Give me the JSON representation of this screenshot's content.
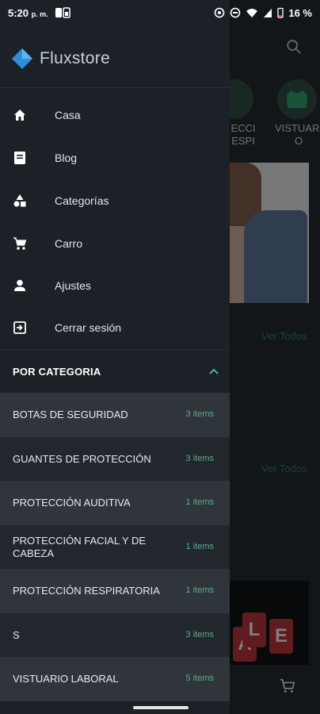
{
  "status_bar": {
    "time": "5:20",
    "ampm": "p. m.",
    "battery": "16 %"
  },
  "drawer": {
    "brand": "Fluxstore",
    "menu": [
      {
        "label": "Casa",
        "icon": "home-icon"
      },
      {
        "label": "Blog",
        "icon": "blog-icon"
      },
      {
        "label": "Categorías",
        "icon": "categories-icon"
      },
      {
        "label": "Carro",
        "icon": "cart-icon"
      },
      {
        "label": "Ajustes",
        "icon": "person-icon"
      },
      {
        "label": "Cerrar sesión",
        "icon": "logout-icon"
      }
    ],
    "category_header": "POR CATEGORIA",
    "categories": [
      {
        "name": "BOTAS DE SEGURIDAD",
        "count": "3 items"
      },
      {
        "name": "GUANTES DE PROTECCIÓN",
        "count": "3 items"
      },
      {
        "name": "PROTECCIÓN AUDITIVA",
        "count": "1 items"
      },
      {
        "name": "PROTECCIÓN FACIAL Y DE CABEZA",
        "count": "1 items"
      },
      {
        "name": "PROTECCIÓN RESPIRATORIA",
        "count": "1 items"
      },
      {
        "name": "S",
        "count": "3 items"
      },
      {
        "name": "VISTUARIO LABORAL",
        "count": "5 items"
      }
    ]
  },
  "background": {
    "cat_label_1": "ECCI\nESPI",
    "cat_label_2": "VISTUARI\nO",
    "see_all_1": "Ver Todos",
    "see_all_2": "Ver Todos",
    "sale_letters": [
      "A",
      "L",
      "E"
    ]
  },
  "colors": {
    "drawer_bg": "#1c2127",
    "row_alt": "#30353c",
    "accent_green": "#5fa886"
  }
}
